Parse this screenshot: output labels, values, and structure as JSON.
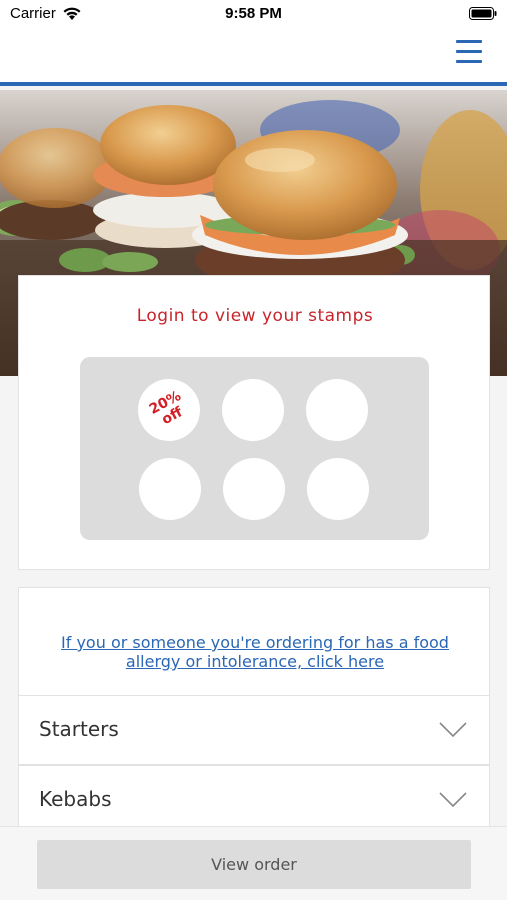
{
  "status_bar": {
    "carrier": "Carrier",
    "time": "9:58 PM",
    "icons": [
      "wifi-icon",
      "battery-icon"
    ]
  },
  "nav": {
    "menu_icon": "hamburger-menu-icon",
    "accent_color": "#2a67b5"
  },
  "hero": {
    "image": "burger-sliders-photo"
  },
  "stamps": {
    "title": "Login to view your stamps",
    "title_color": "#c8242b",
    "reward_line1": "20%",
    "reward_line2": "off",
    "total_slots": 6
  },
  "allergy": {
    "link_text": "If you or someone you're ordering for has a food allergy or intolerance, click here"
  },
  "categories": [
    {
      "label": "Starters"
    },
    {
      "label": "Kebabs"
    }
  ],
  "footer": {
    "view_order_label": "View order"
  }
}
